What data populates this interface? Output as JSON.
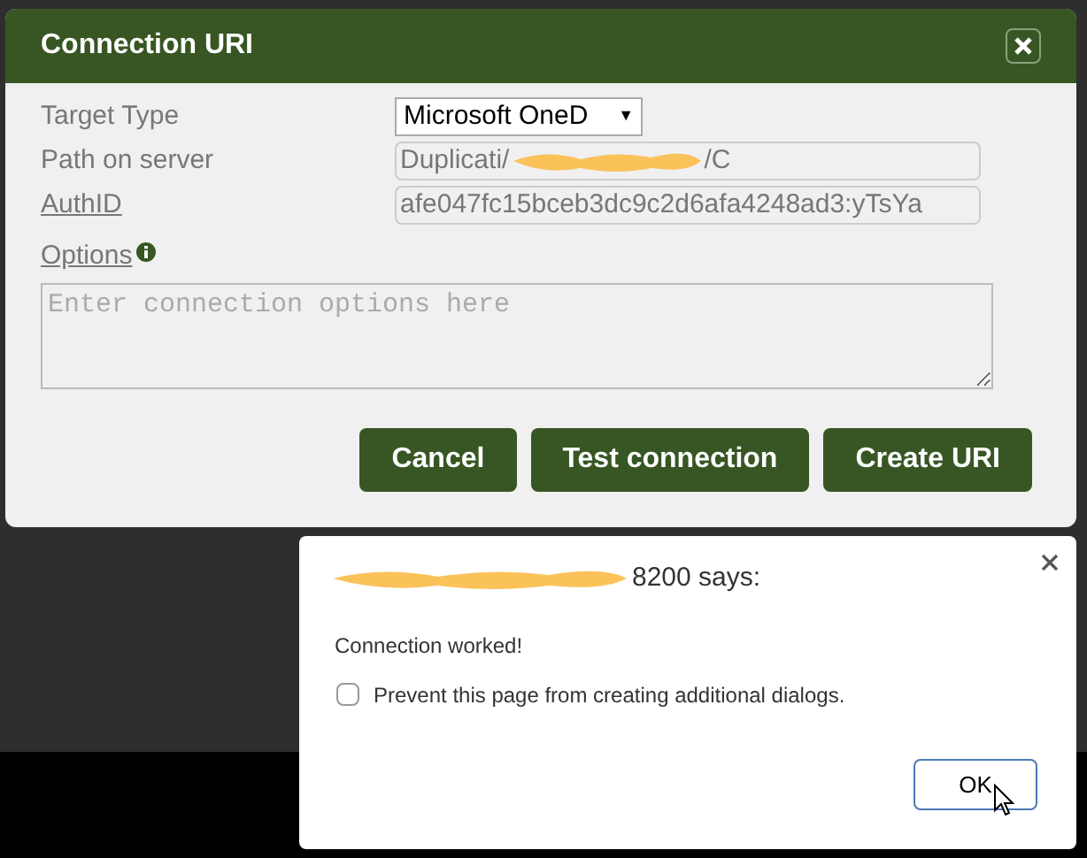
{
  "dialog": {
    "title": "Connection URI",
    "fields": [
      {
        "kind": "select",
        "label": "Target Type",
        "underlined": false,
        "value": "Microsoft OneD",
        "caret": "▼"
      },
      {
        "kind": "text",
        "label": "Path on server",
        "underlined": false,
        "value_start": "Duplicati/",
        "value_end": "/C",
        "redacted": true
      },
      {
        "kind": "text",
        "label": "AuthID",
        "underlined": true,
        "value_start": "afe047fc15bceb3dc9c2d6afa4248ad3:yTsYa",
        "redacted": false
      },
      {
        "kind": "textarea",
        "label": "Options",
        "underlined": true,
        "info": true,
        "placeholder": "Enter connection options here"
      }
    ],
    "buttons": [
      "Cancel",
      "Test connection",
      "Create URI"
    ]
  },
  "alert": {
    "title": "8200 says:",
    "title_redacted": true,
    "message": "Connection worked!",
    "checkbox": {
      "label": "Prevent this page from creating additional dialogs.",
      "checked": false
    },
    "button": "OK"
  }
}
